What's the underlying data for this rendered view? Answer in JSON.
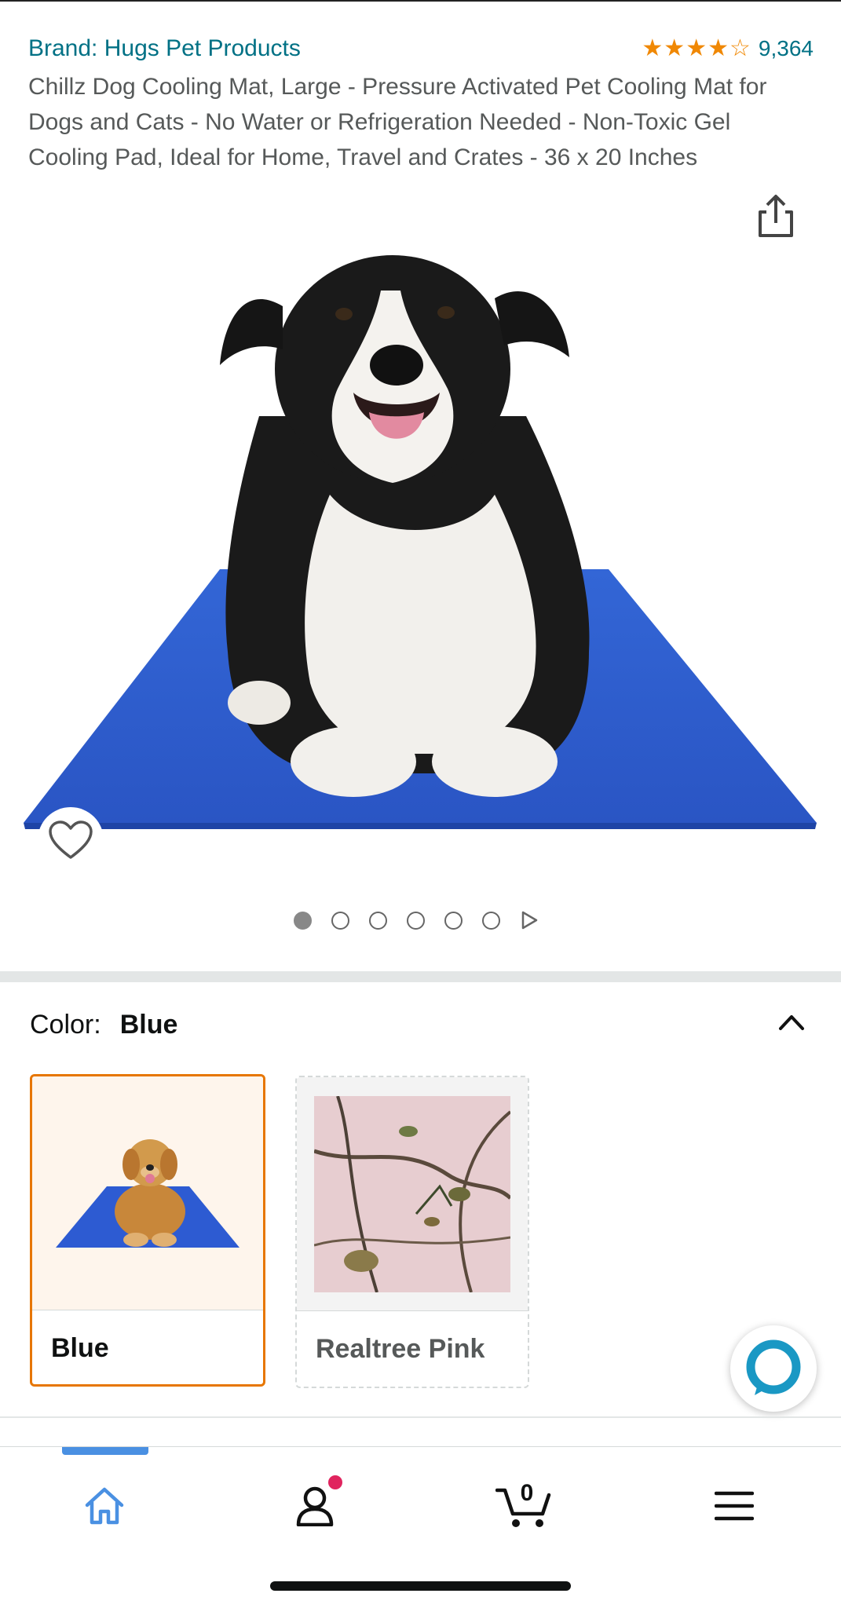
{
  "product": {
    "brand": "Brand: Hugs Pet Products",
    "rating": {
      "value_stars": 4.5,
      "max_stars": 5,
      "count": "9,364"
    },
    "title": "Chillz Dog Cooling Mat, Large - Pressure Activated Pet Cooling Mat for Dogs and Cats - No Water or Refrigeration Needed - Non-Toxic Gel Cooling Pad, Ideal for Home, Travel and Crates - 36 x 20 Inches"
  },
  "gallery": {
    "image_count": 6,
    "active_index": 0,
    "icons": {
      "share": "share-icon",
      "wishlist": "heart-icon",
      "next": "play-arrow-icon"
    }
  },
  "variation": {
    "label": "Color:",
    "selected": "Blue",
    "options": [
      {
        "label": "Blue",
        "state": "selected"
      },
      {
        "label": "Realtree Pink",
        "state": "unavailable"
      }
    ]
  },
  "colors": {
    "link": "#007185",
    "star": "#F08804",
    "selected_border": "#E77600",
    "mat_blue": "#2D5BD2",
    "alexa": "#1A98C4",
    "nav_active": "#4A90E2",
    "notification": "#E0245E"
  },
  "bottom_nav": {
    "items": [
      {
        "name": "home",
        "icon": "home-icon",
        "active": true
      },
      {
        "name": "account",
        "icon": "user-icon",
        "notification": true
      },
      {
        "name": "cart",
        "icon": "cart-icon",
        "count": "0"
      },
      {
        "name": "menu",
        "icon": "hamburger-icon"
      }
    ]
  }
}
